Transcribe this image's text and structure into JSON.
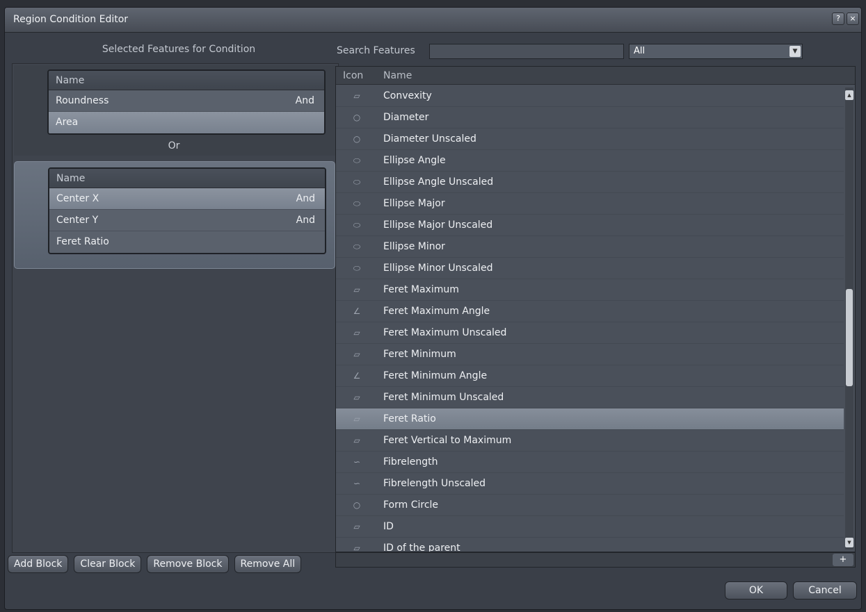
{
  "window": {
    "title": "Region Condition Editor",
    "help": "?",
    "close": "×"
  },
  "left": {
    "header": "Selected Features for Condition",
    "or_label": "Or",
    "blocks": [
      {
        "header": "Name",
        "rows": [
          {
            "name": "Roundness",
            "op": "And"
          },
          {
            "name": "Area",
            "op": ""
          }
        ]
      },
      {
        "header": "Name",
        "rows": [
          {
            "name": "Center X",
            "op": "And"
          },
          {
            "name": "Center Y",
            "op": "And"
          },
          {
            "name": "Feret Ratio",
            "op": ""
          }
        ]
      }
    ],
    "buttons": {
      "add": "Add Block",
      "clear": "Clear Block",
      "remove": "Remove Block",
      "remove_all": "Remove All"
    }
  },
  "search": {
    "label": "Search Features",
    "value": "",
    "filter": "All"
  },
  "list": {
    "col_icon": "Icon",
    "col_name": "Name",
    "rows": [
      {
        "icon": "▱",
        "name": "Convexity"
      },
      {
        "icon": "○",
        "name": "Diameter"
      },
      {
        "icon": "○",
        "name": "Diameter Unscaled"
      },
      {
        "icon": "⬭",
        "name": "Ellipse Angle"
      },
      {
        "icon": "⬭",
        "name": "Ellipse Angle Unscaled"
      },
      {
        "icon": "⬭",
        "name": "Ellipse Major"
      },
      {
        "icon": "⬭",
        "name": "Ellipse Major Unscaled"
      },
      {
        "icon": "⬭",
        "name": "Ellipse Minor"
      },
      {
        "icon": "⬭",
        "name": "Ellipse Minor Unscaled"
      },
      {
        "icon": "▱",
        "name": "Feret Maximum"
      },
      {
        "icon": "∠",
        "name": "Feret Maximum Angle"
      },
      {
        "icon": "▱",
        "name": "Feret Maximum Unscaled"
      },
      {
        "icon": "▱",
        "name": "Feret Minimum"
      },
      {
        "icon": "∠",
        "name": "Feret Minimum Angle"
      },
      {
        "icon": "▱",
        "name": "Feret Minimum Unscaled"
      },
      {
        "icon": "▱",
        "name": "Feret Ratio"
      },
      {
        "icon": "▱",
        "name": "Feret Vertical to Maximum"
      },
      {
        "icon": "∽",
        "name": "Fibrelength"
      },
      {
        "icon": "∽",
        "name": "Fibrelength Unscaled"
      },
      {
        "icon": "○",
        "name": "Form Circle"
      },
      {
        "icon": "▱",
        "name": "ID"
      },
      {
        "icon": "▱",
        "name": "ID of the parent"
      }
    ],
    "add": "+"
  },
  "footer": {
    "ok": "OK",
    "cancel": "Cancel"
  }
}
